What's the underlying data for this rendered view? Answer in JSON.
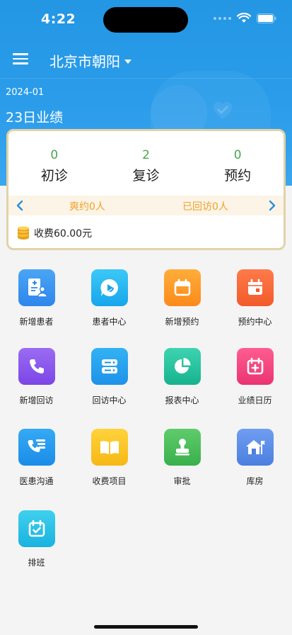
{
  "status": {
    "time": "4:22"
  },
  "nav": {
    "city": "北京市朝阳"
  },
  "summary": {
    "month": "2024-01",
    "daily_title": "23日业绩",
    "stats": [
      {
        "value": "0",
        "label": "初诊"
      },
      {
        "value": "2",
        "label": "复诊"
      },
      {
        "value": "0",
        "label": "预约"
      }
    ],
    "missed": "爽约0人",
    "followed": "已回访0人",
    "fee": "收费60.00元"
  },
  "menu": [
    {
      "label": "新增患者",
      "icon": "add-patient-icon",
      "color_top": "#4aa5f5",
      "color_bottom": "#2e86ec"
    },
    {
      "label": "患者中心",
      "icon": "patient-center-icon",
      "color_top": "#3cc8f6",
      "color_bottom": "#16a6ec"
    },
    {
      "label": "新增预约",
      "icon": "calendar-icon",
      "color_top": "#ffad3a",
      "color_bottom": "#fb8a1a"
    },
    {
      "label": "预约中心",
      "icon": "calendar-center-icon",
      "color_top": "#ff7a4a",
      "color_bottom": "#f25b2b"
    },
    {
      "label": "新增回访",
      "icon": "phone-icon",
      "color_top": "#9a6cf2",
      "color_bottom": "#7b46e6"
    },
    {
      "label": "回访中心",
      "icon": "server-list-icon",
      "color_top": "#33b2f4",
      "color_bottom": "#1e92e8"
    },
    {
      "label": "报表中心",
      "icon": "pie-chart-icon",
      "color_top": "#3dd4b0",
      "color_bottom": "#17b38e"
    },
    {
      "label": "业绩日历",
      "icon": "calendar-plus-icon",
      "color_top": "#ff5c92",
      "color_bottom": "#ea3471"
    },
    {
      "label": "医患沟通",
      "icon": "phone-chat-icon",
      "color_top": "#35aaf5",
      "color_bottom": "#1b8ce7"
    },
    {
      "label": "收费项目",
      "icon": "book-icon",
      "color_top": "#ffd33a",
      "color_bottom": "#f6b815"
    },
    {
      "label": "审批",
      "icon": "stamp-icon",
      "color_top": "#5fcc6c",
      "color_bottom": "#39b04b"
    },
    {
      "label": "库房",
      "icon": "warehouse-icon",
      "color_top": "#6f9df0",
      "color_bottom": "#4b7fe0"
    },
    {
      "label": "排班",
      "icon": "calendar-check-icon",
      "color_top": "#3fd0ee",
      "color_bottom": "#18b3e0"
    }
  ]
}
